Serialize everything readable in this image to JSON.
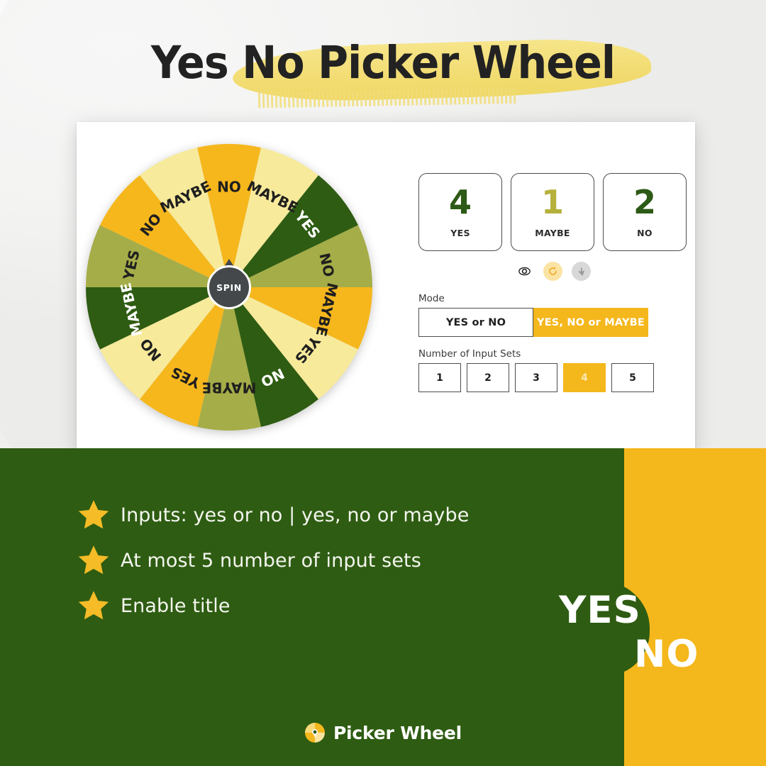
{
  "page": {
    "title": "Yes No Picker Wheel",
    "background_color": "#fdfdfd",
    "green_color": "#2e5c12",
    "yellow_color": "#f4b71c"
  },
  "wheel": {
    "spin_label": "SPIN",
    "segment_count": 14,
    "segments": [
      {
        "label": "NO",
        "color": "#f6b71d",
        "text_color": "#1f1f1f"
      },
      {
        "label": "MAYBE",
        "color": "#f7ea9b",
        "text_color": "#1f1f1f"
      },
      {
        "label": "YES",
        "color": "#2e5c12",
        "text_color": "#ffffff"
      },
      {
        "label": "NO",
        "color": "#a5ad48",
        "text_color": "#1f1f1f"
      },
      {
        "label": "MAYBE",
        "color": "#f6b71d",
        "text_color": "#1f1f1f"
      },
      {
        "label": "YES",
        "color": "#f7ea9b",
        "text_color": "#1f1f1f"
      },
      {
        "label": "NO",
        "color": "#2e5c12",
        "text_color": "#ffffff"
      },
      {
        "label": "MAYBE",
        "color": "#a5ad48",
        "text_color": "#1f1f1f"
      },
      {
        "label": "YES",
        "color": "#f6b71d",
        "text_color": "#1f1f1f"
      },
      {
        "label": "NO",
        "color": "#f7ea9b",
        "text_color": "#1f1f1f"
      },
      {
        "label": "MAYBE",
        "color": "#2e5c12",
        "text_color": "#ffffff"
      },
      {
        "label": "YES",
        "color": "#a5ad48",
        "text_color": "#1f1f1f"
      },
      {
        "label": "NO",
        "color": "#f6b71d",
        "text_color": "#1f1f1f"
      },
      {
        "label": "MAYBE",
        "color": "#f7ea9b",
        "text_color": "#1f1f1f"
      }
    ]
  },
  "results": [
    {
      "count": "4",
      "label": "YES",
      "color": "#2d5a16"
    },
    {
      "count": "1",
      "label": "MAYBE",
      "color": "#b5b13c"
    },
    {
      "count": "2",
      "label": "NO",
      "color": "#2d5a16"
    }
  ],
  "tool_icons": [
    {
      "name": "eye-icon",
      "style": "plain"
    },
    {
      "name": "refresh-icon",
      "style": "amber"
    },
    {
      "name": "cursor-icon",
      "style": "grey"
    }
  ],
  "mode": {
    "label": "Mode",
    "options": [
      {
        "text": "YES or NO",
        "selected": false
      },
      {
        "text": "YES, NO or MAYBE",
        "selected": true
      }
    ]
  },
  "input_sets": {
    "label": "Number of Input Sets",
    "options": [
      {
        "text": "1",
        "selected": false
      },
      {
        "text": "2",
        "selected": false
      },
      {
        "text": "3",
        "selected": false
      },
      {
        "text": "4",
        "selected": true
      },
      {
        "text": "5",
        "selected": false
      }
    ]
  },
  "features": [
    "Inputs: yes or no | yes, no or maybe",
    "At most 5 number of input sets",
    "Enable title"
  ],
  "yesno_graphic": {
    "yes": "YES",
    "no": "NO"
  },
  "footer": {
    "brand": "Picker Wheel"
  }
}
